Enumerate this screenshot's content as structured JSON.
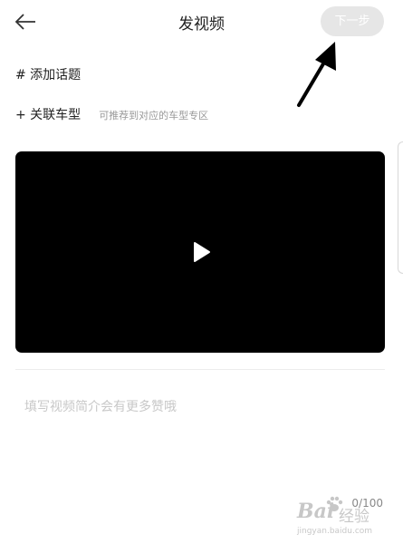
{
  "header": {
    "back_icon": "arrow-left-icon",
    "title": "发视频",
    "next_label": "下一步"
  },
  "topic": {
    "label": "# 添加话题"
  },
  "car": {
    "label": "+ 关联车型",
    "hint": "可推荐到对应的车型专区"
  },
  "video": {
    "play_icon": "play-icon"
  },
  "description": {
    "placeholder": "填写视频简介会有更多赞哦",
    "value": ""
  },
  "counter": {
    "text": "0/100"
  },
  "annotation": {
    "arrow_icon": "arrow-pointer-icon"
  },
  "watermark": {
    "brand": "Bai",
    "cn": "经验",
    "url": "jingyan.baidu.com"
  }
}
